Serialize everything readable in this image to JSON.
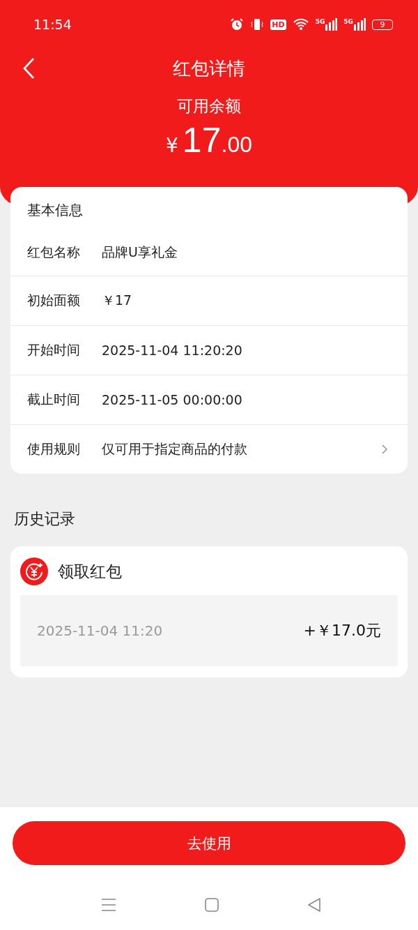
{
  "status_bar": {
    "time": "11:54",
    "hd": "HD",
    "networks": [
      "5G",
      "5G"
    ],
    "battery": "9"
  },
  "header": {
    "title": "红包详情",
    "balance_label": "可用余额",
    "currency": "¥",
    "amount_integer": "17",
    "amount_decimal": ".00"
  },
  "basic_info": {
    "title": "基本信息",
    "rows": [
      {
        "kind": "plain",
        "label": "红包名称",
        "value": "品牌U享礼金"
      },
      {
        "kind": "plain",
        "label": "初始面额",
        "value": "￥17"
      },
      {
        "kind": "plain",
        "label": "开始时间",
        "value": "2025-11-04 11:20:20"
      },
      {
        "kind": "plain",
        "label": "截止时间",
        "value": "2025-11-05 00:00:00"
      },
      {
        "kind": "link",
        "label": "使用规则",
        "value": "仅可用于指定商品的付款"
      }
    ]
  },
  "history": {
    "title": "历史记录",
    "records": [
      {
        "title": "领取红包",
        "time": "2025-11-04 11:20",
        "amount": "+￥17.0元"
      }
    ]
  },
  "use_button": "去使用"
}
